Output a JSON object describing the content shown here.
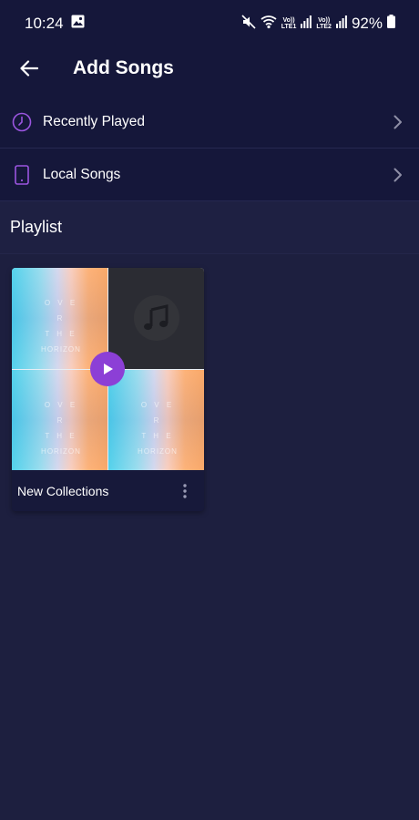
{
  "status_bar": {
    "time": "10:24",
    "lte1_top": "Vo))",
    "lte1_bottom": "LTE1",
    "lte2_top": "Vo))",
    "lte2_bottom": "LTE2",
    "battery": "92%"
  },
  "app_bar": {
    "title": "Add Songs"
  },
  "menu": {
    "items": [
      {
        "label": "Recently Played",
        "icon": "clock-icon"
      },
      {
        "label": "Local Songs",
        "icon": "phone-icon"
      }
    ]
  },
  "playlist_section": {
    "title": "Playlist"
  },
  "playlists": [
    {
      "name": "New Collections",
      "cover_text": [
        "O V E R",
        "T H E",
        "HORIZON"
      ]
    }
  ],
  "colors": {
    "background": "#1d1f3f",
    "top_background": "#15173a",
    "accent": "#8c3fd6",
    "icon_purple": "#9b55e0"
  }
}
